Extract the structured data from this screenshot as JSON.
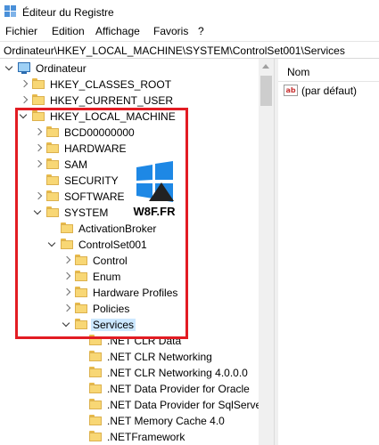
{
  "window": {
    "title": "Éditeur du Registre"
  },
  "menu": {
    "items": [
      "Fichier",
      "Edition",
      "Affichage",
      "Favoris",
      "?"
    ]
  },
  "address": {
    "path": "Ordinateur\\HKEY_LOCAL_MACHINE\\SYSTEM\\ControlSet001\\Services"
  },
  "tree": {
    "nodes": [
      {
        "label": "Ordinateur",
        "state": "open",
        "icon": "computer-icon"
      },
      {
        "label": "HKEY_CLASSES_ROOT",
        "state": "closed",
        "icon": "folder-icon"
      },
      {
        "label": "HKEY_CURRENT_USER",
        "state": "closed",
        "icon": "folder-icon"
      },
      {
        "label": "HKEY_LOCAL_MACHINE",
        "state": "open",
        "icon": "folder-icon"
      },
      {
        "label": "BCD00000000",
        "state": "closed",
        "icon": "folder-icon"
      },
      {
        "label": "HARDWARE",
        "state": "closed",
        "icon": "folder-icon"
      },
      {
        "label": "SAM",
        "state": "closed",
        "icon": "folder-icon"
      },
      {
        "label": "SECURITY",
        "state": "none",
        "icon": "folder-icon"
      },
      {
        "label": "SOFTWARE",
        "state": "closed",
        "icon": "folder-icon"
      },
      {
        "label": "SYSTEM",
        "state": "open",
        "icon": "folder-icon"
      },
      {
        "label": "ActivationBroker",
        "state": "none",
        "icon": "folder-icon"
      },
      {
        "label": "ControlSet001",
        "state": "open",
        "icon": "folder-icon"
      },
      {
        "label": "Control",
        "state": "closed",
        "icon": "folder-icon"
      },
      {
        "label": "Enum",
        "state": "closed",
        "icon": "folder-icon"
      },
      {
        "label": "Hardware Profiles",
        "state": "closed",
        "icon": "folder-icon"
      },
      {
        "label": "Policies",
        "state": "closed",
        "icon": "folder-icon"
      },
      {
        "label": "Services",
        "state": "open",
        "icon": "folder-icon",
        "selected": true
      },
      {
        "label": ".NET CLR Data",
        "state": "none",
        "icon": "folder-icon"
      },
      {
        "label": ".NET CLR Networking",
        "state": "none",
        "icon": "folder-icon"
      },
      {
        "label": ".NET CLR Networking 4.0.0.0",
        "state": "none",
        "icon": "folder-icon"
      },
      {
        "label": ".NET Data Provider for Oracle",
        "state": "none",
        "icon": "folder-icon"
      },
      {
        "label": ".NET Data Provider for SqlServer",
        "state": "none",
        "icon": "folder-icon"
      },
      {
        "label": ".NET Memory Cache 4.0",
        "state": "none",
        "icon": "folder-icon"
      },
      {
        "label": ".NETFramework",
        "state": "none",
        "icon": "folder-icon"
      }
    ]
  },
  "list": {
    "column_name": "Nom",
    "rows": [
      {
        "name": "(par défaut)",
        "icon": "string-value-icon"
      }
    ]
  },
  "watermark": {
    "text": "W8F.FR"
  },
  "colors": {
    "highlight": "#e21c23",
    "selection": "#cce8ff",
    "folder": "#f8d775"
  }
}
